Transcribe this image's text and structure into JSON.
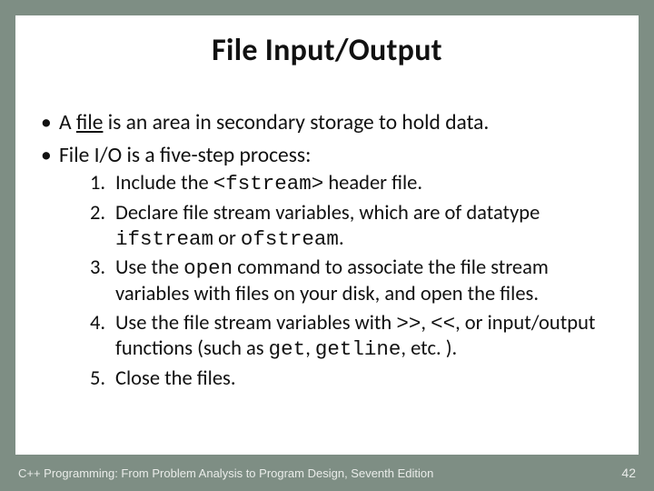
{
  "title": "File Input/Output",
  "bullets": {
    "b1_pre": "A ",
    "b1_underlined": "file",
    "b1_post": " is an area in secondary storage to hold data.",
    "b2": "File I/O is a five-step process:"
  },
  "steps": {
    "s1_pre": "Include the ",
    "s1_code": "<fstream>",
    "s1_post": " header file.",
    "s2_pre": "Declare file stream variables, which are of datatype ",
    "s2_code1": "ifstream",
    "s2_mid": " or ",
    "s2_code2": "ofstream",
    "s2_post": ".",
    "s3_pre": "Use the ",
    "s3_code": "open",
    "s3_post": " command to associate the file stream variables with files on your disk, and open the files.",
    "s4_pre": "Use the file stream variables with ",
    "s4_code1": ">>",
    "s4_mid1": ", ",
    "s4_code2": "<<",
    "s4_mid2": ", or input/output functions (such as ",
    "s4_code3": "get",
    "s4_mid3": ", ",
    "s4_code4": "getline",
    "s4_post": ", etc. ).",
    "s5": "Close the files."
  },
  "footer": {
    "left": "C++ Programming: From Problem Analysis to Program Design, Seventh Edition",
    "right": "42"
  }
}
